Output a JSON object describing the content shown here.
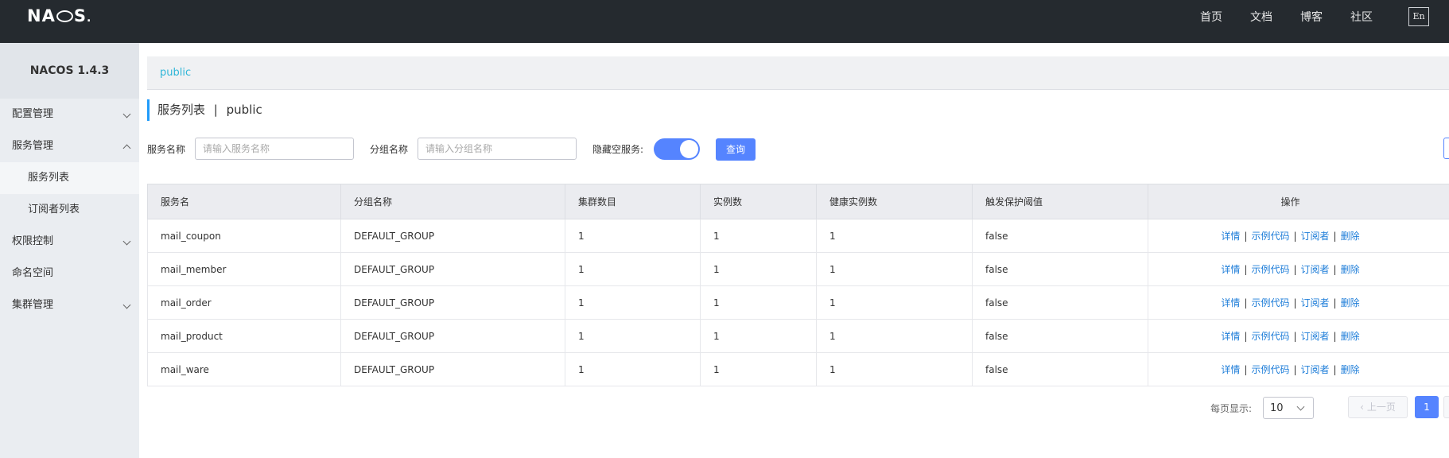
{
  "header": {
    "logo": "NACOS",
    "nav": [
      "首页",
      "文档",
      "博客",
      "社区"
    ],
    "lang_button": "En"
  },
  "sidebar": {
    "version": "NACOS 1.4.3",
    "items": [
      {
        "label": "配置管理"
      },
      {
        "label": "服务管理"
      },
      {
        "label": "服务列表"
      },
      {
        "label": "订阅者列表"
      },
      {
        "label": "权限控制"
      },
      {
        "label": "命名空间"
      },
      {
        "label": "集群管理"
      }
    ]
  },
  "breadcrumb": "public",
  "page": {
    "title": "服务列表",
    "separator": "|",
    "namespace": "public"
  },
  "filters": {
    "service_name_label": "服务名称",
    "service_name_placeholder": "请输入服务名称",
    "group_name_label": "分组名称",
    "group_name_placeholder": "请输入分组名称",
    "hide_empty_label": "隐藏空服务:",
    "hide_empty_on": true,
    "query_button": "查询"
  },
  "table": {
    "headers": [
      "服务名",
      "分组名称",
      "集群数目",
      "实例数",
      "健康实例数",
      "触发保护阈值",
      "操作"
    ],
    "rows": [
      [
        "mail_coupon",
        "DEFAULT_GROUP",
        "1",
        "1",
        "1",
        "false"
      ],
      [
        "mail_member",
        "DEFAULT_GROUP",
        "1",
        "1",
        "1",
        "false"
      ],
      [
        "mail_order",
        "DEFAULT_GROUP",
        "1",
        "1",
        "1",
        "false"
      ],
      [
        "mail_product",
        "DEFAULT_GROUP",
        "1",
        "1",
        "1",
        "false"
      ],
      [
        "mail_ware",
        "DEFAULT_GROUP",
        "1",
        "1",
        "1",
        "false"
      ]
    ],
    "actions": [
      "详情",
      "示例代码",
      "订阅者",
      "删除"
    ]
  },
  "pagination": {
    "per_page_label": "每页显示:",
    "per_page_value": "10",
    "prev_label": "上一页",
    "current_page": "1"
  },
  "colors": {
    "topbar": "#252a2f",
    "primary": "#5584ff",
    "link": "#1c7cd8",
    "breadcrumb": "#2fb6d8"
  }
}
